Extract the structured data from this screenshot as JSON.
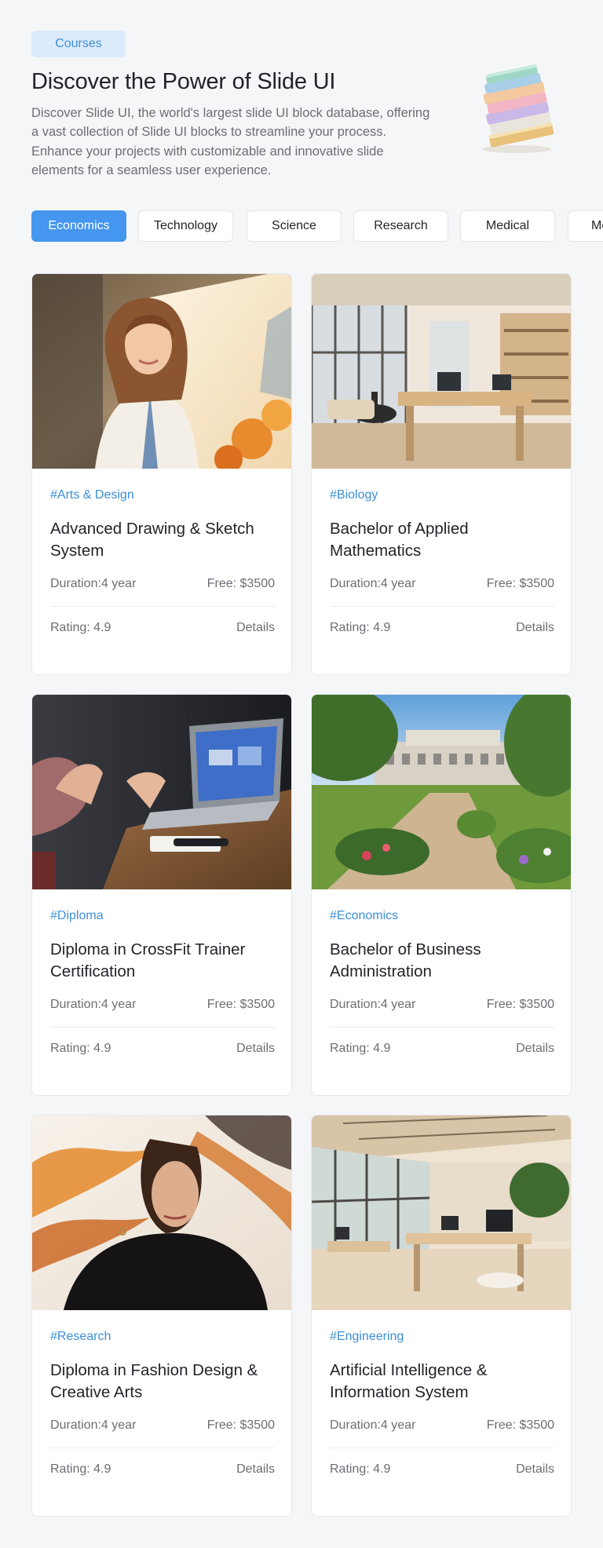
{
  "header": {
    "badge": "Courses",
    "title": "Discover the Power of Slide UI",
    "description": "Discover Slide UI, the world's largest slide UI block database, offering a vast collection of Slide UI blocks to streamline your process. Enhance your projects with customizable and innovative slide elements for a seamless user experience."
  },
  "tabs": [
    {
      "label": "Economics",
      "active": true
    },
    {
      "label": "Technology",
      "active": false
    },
    {
      "label": "Science",
      "active": false
    },
    {
      "label": "Research",
      "active": false
    },
    {
      "label": "Medical",
      "active": false
    },
    {
      "label": "Medical",
      "active": false
    }
  ],
  "cards": [
    {
      "tag": "#Arts & Design",
      "title": "Advanced Drawing & Sketch System",
      "duration": "Duration:4 year",
      "fee": "Free: $3500",
      "rating": "Rating: 4.9",
      "details": "Details",
      "image": "woman-painting-photo"
    },
    {
      "tag": "#Biology",
      "title": "Bachelor of Applied Mathematics",
      "duration": "Duration:4 year",
      "fee": "Free: $3500",
      "rating": "Rating: 4.9",
      "details": "Details",
      "image": "office-interior-photo"
    },
    {
      "tag": "#Diploma",
      "title": "Diploma in CrossFit  Trainer Certification",
      "duration": "Duration:4 year",
      "fee": "Free: $3500",
      "rating": "Rating: 4.9",
      "details": "Details",
      "image": "laptop-hands-photo"
    },
    {
      "tag": "#Economics",
      "title": "Bachelor of Business Administration",
      "duration": "Duration:4 year",
      "fee": "Free: $3500",
      "rating": "Rating: 4.9",
      "details": "Details",
      "image": "campus-garden-photo"
    },
    {
      "tag": "#Research",
      "title": "Diploma in Fashion Design & Creative Arts",
      "duration": "Duration:4 year",
      "fee": "Free: $3500",
      "rating": "Rating: 4.9",
      "details": "Details",
      "image": "fashion-portrait-photo"
    },
    {
      "tag": "#Engineering",
      "title": "Artificial Intelligence & Information System",
      "duration": "Duration:4 year",
      "fee": "Free: $3500",
      "rating": "Rating: 4.9",
      "details": "Details",
      "image": "open-office-photo"
    }
  ],
  "colors": {
    "accent": "#4596ee",
    "tag": "#3d8fd6",
    "badge_bg": "#dcebfb",
    "page_bg": "#f5f6f8"
  }
}
